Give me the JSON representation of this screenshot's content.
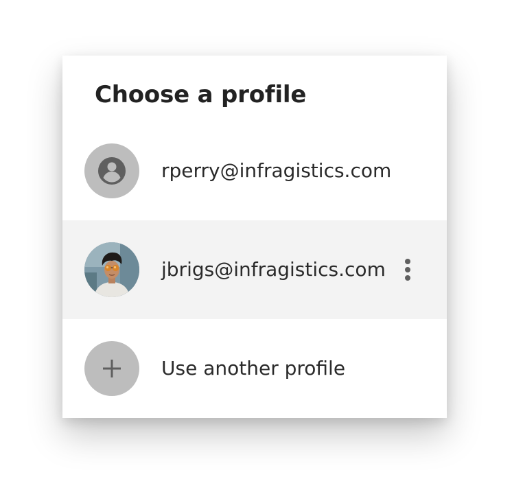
{
  "dialog": {
    "title": "Choose a profile",
    "profiles": [
      {
        "email": "rperry@infragistics.com",
        "avatar": "account-circle-icon"
      },
      {
        "email": "jbrigs@infragistics.com",
        "avatar": "user-photo",
        "selected": true,
        "menu_icon": "more-vert-icon"
      }
    ],
    "add_profile_label": "Use another profile",
    "add_icon": "plus-icon"
  },
  "colors": {
    "avatar_bg": "#bdbdbd",
    "selected_row_bg": "#f3f3f3",
    "text": "#2a2a2a",
    "icon": "#5f5f5f"
  }
}
